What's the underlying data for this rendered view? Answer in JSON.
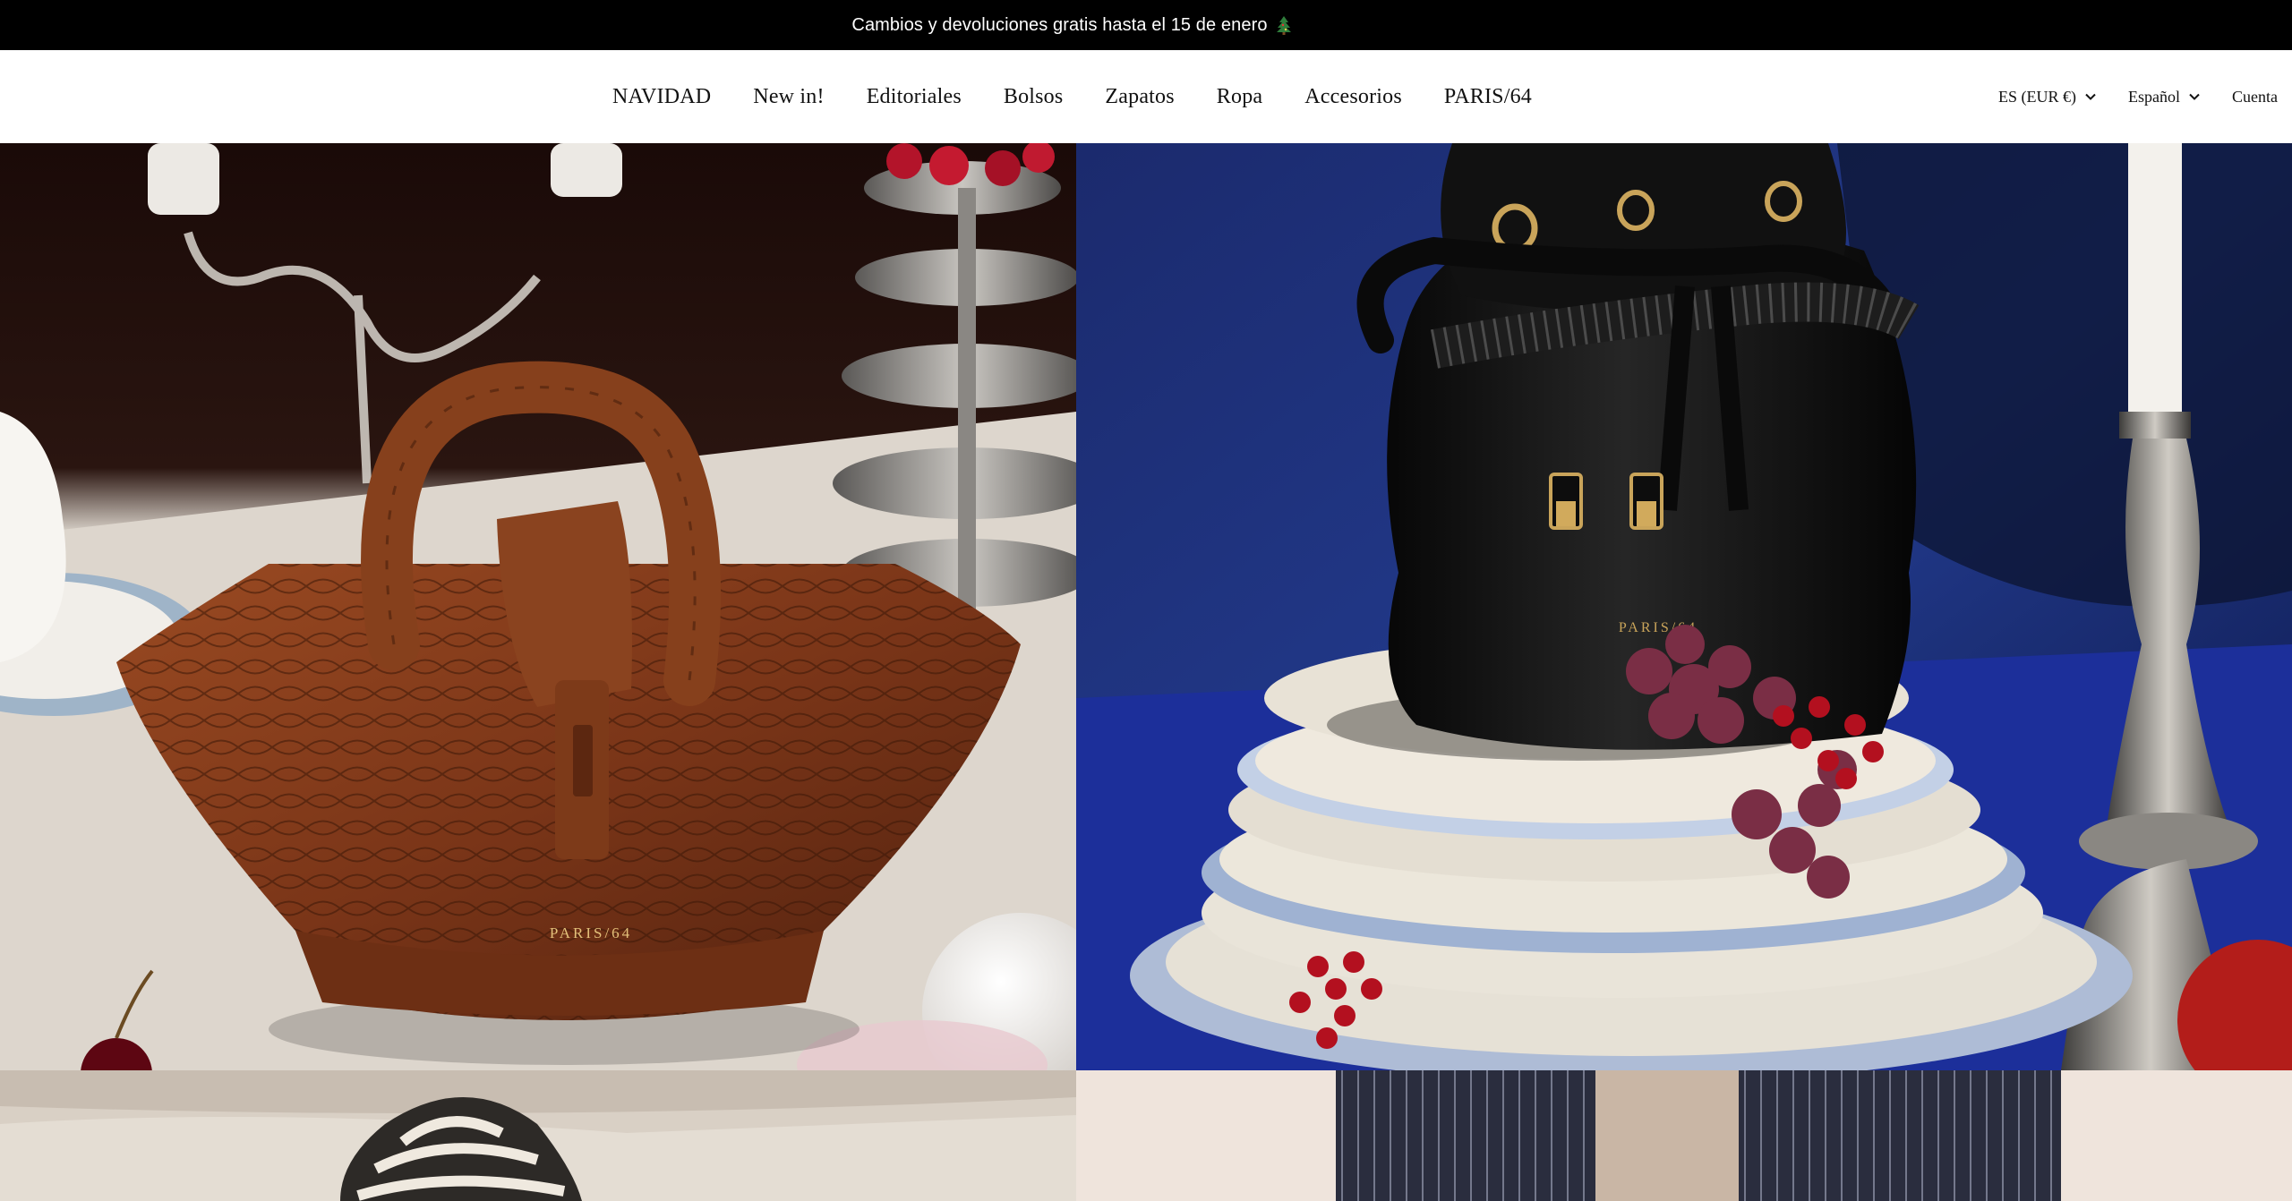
{
  "announcement": {
    "text": "Cambios y devoluciones gratis hasta el 15 de enero",
    "icon": "christmas-tree-icon"
  },
  "nav": {
    "items": [
      {
        "label": "NAVIDAD"
      },
      {
        "label": "New in!"
      },
      {
        "label": "Editoriales"
      },
      {
        "label": "Bolsos"
      },
      {
        "label": "Zapatos"
      },
      {
        "label": "Ropa"
      },
      {
        "label": "Accesorios"
      },
      {
        "label": "PARIS/64"
      }
    ]
  },
  "utils": {
    "currency": "ES (EUR €)",
    "language": "Español",
    "account": "Cuenta"
  },
  "hero": {
    "left_brand_stamp": "PARIS/64",
    "right_brand_stamp": "PARIS/64"
  },
  "colors": {
    "announcement_bg": "#000000",
    "left_bag": "#7a3a1c",
    "right_bg": "#1f2f7a",
    "right_bag": "#0c0c0c"
  }
}
